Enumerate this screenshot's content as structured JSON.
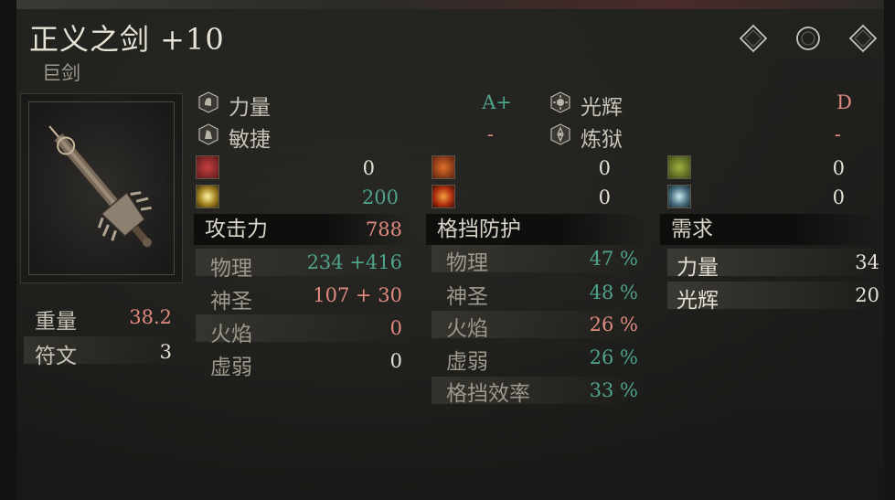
{
  "item": {
    "name": "正义之剑 +10",
    "type": "巨剑"
  },
  "scaling": [
    {
      "label": "力量",
      "grade": "A+",
      "icon": "strength-icon"
    },
    {
      "label": "敏捷",
      "grade": "-",
      "icon": "dexterity-icon"
    },
    {
      "label": "光辉",
      "grade": "D",
      "icon": "faith-icon"
    },
    {
      "label": "炼狱",
      "grade": "-",
      "icon": "arcane-icon"
    }
  ],
  "effects": [
    {
      "icon": "bleed-icon",
      "value": "0"
    },
    {
      "icon": "holy-light-icon",
      "value": "200"
    },
    {
      "icon": "fire-icon",
      "value": "0"
    },
    {
      "icon": "explosion-icon",
      "value": "0"
    },
    {
      "icon": "poison-icon",
      "value": "0"
    },
    {
      "icon": "frost-icon",
      "value": "0"
    }
  ],
  "attack": {
    "header": "攻击力",
    "total": "788",
    "rows": [
      {
        "label": "物理",
        "value": "234 +416"
      },
      {
        "label": "神圣",
        "value": "107 + 30"
      },
      {
        "label": "火焰",
        "value": "0"
      },
      {
        "label": "虚弱",
        "value": "0"
      }
    ]
  },
  "guard": {
    "header": "格挡防护",
    "rows": [
      {
        "label": "物理",
        "value": "47 %"
      },
      {
        "label": "神圣",
        "value": "48 %"
      },
      {
        "label": "火焰",
        "value": "26 %"
      },
      {
        "label": "虚弱",
        "value": "26 %"
      },
      {
        "label": "格挡效率",
        "value": "33 %"
      }
    ]
  },
  "requirements": {
    "header": "需求",
    "rows": [
      {
        "label": "力量",
        "value": "34"
      },
      {
        "label": "光辉",
        "value": "20"
      }
    ]
  },
  "weight": {
    "label": "重量",
    "value": "38.2"
  },
  "runes": {
    "label": "符文",
    "value": "3"
  },
  "colors": {
    "green": "#4fa38a",
    "red": "#e08a80",
    "white": "#e4e0d4"
  }
}
